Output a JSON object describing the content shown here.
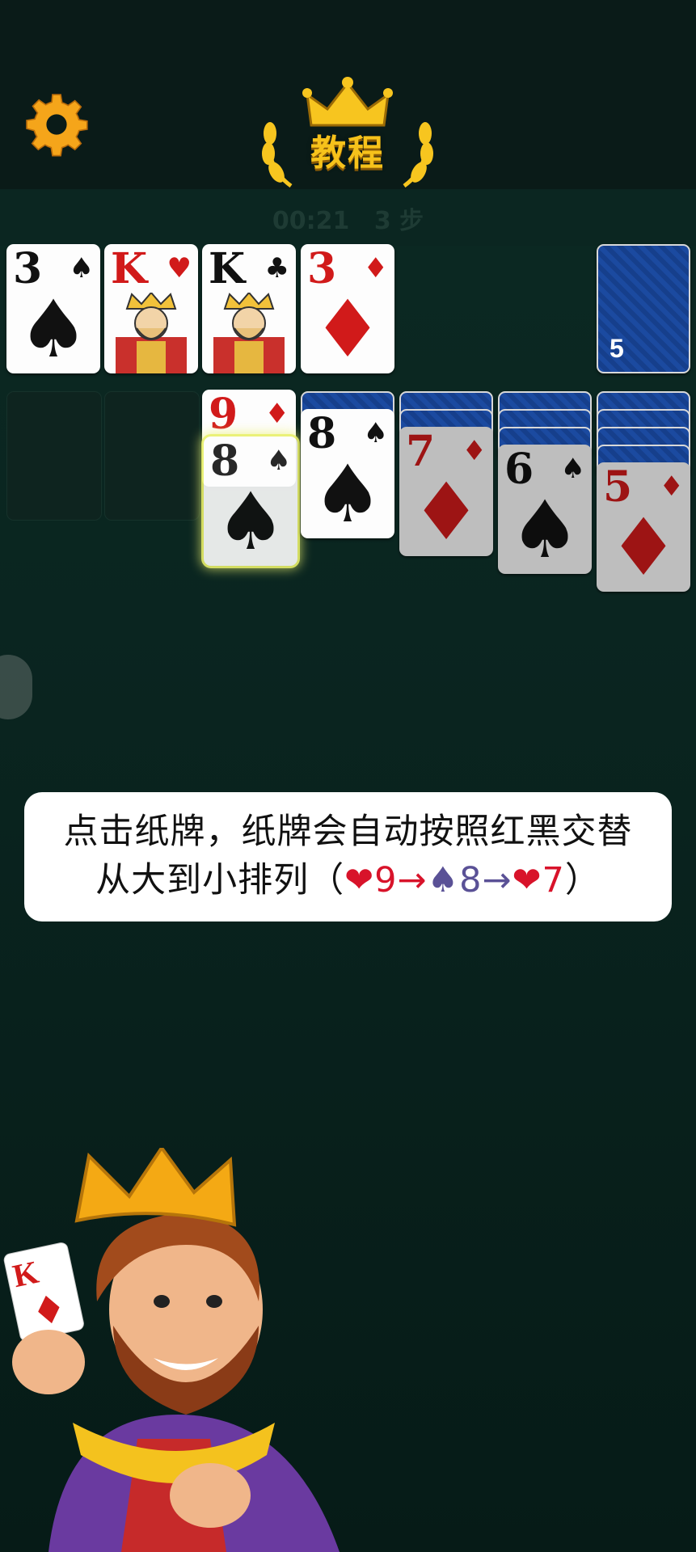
{
  "header": {
    "title": "教程",
    "settings_icon": "gear-icon",
    "crown_icon": "crown-icon",
    "accent_color": "#f6c21b"
  },
  "stats": {
    "timer": "00:21",
    "moves": "3 步"
  },
  "foundations": [
    {
      "rank": "3",
      "suit": "♠",
      "color": "black"
    },
    {
      "rank": "K",
      "suit": "♥",
      "color": "red",
      "face": "king"
    },
    {
      "rank": "K",
      "suit": "♣",
      "color": "black",
      "face": "king"
    },
    {
      "rank": "3",
      "suit": "♦",
      "color": "red"
    }
  ],
  "stock": {
    "count": "5"
  },
  "tableau": {
    "col3": [
      {
        "rank": "9",
        "suit": "♦",
        "color": "red"
      },
      {
        "rank": "8",
        "suit": "♠",
        "color": "black",
        "selected": true
      }
    ],
    "col4": {
      "rank": "8",
      "suit": "♠",
      "color": "black"
    },
    "col5": {
      "rank": "7",
      "suit": "♦",
      "color": "red"
    },
    "col6": {
      "rank": "6",
      "suit": "♠",
      "color": "black"
    },
    "col7": {
      "rank": "5",
      "suit": "♦",
      "color": "red"
    }
  },
  "tutorial": {
    "line1": "点击纸牌，纸牌会自动按照红黑交替",
    "line2_prefix": "从大到小排列（",
    "h_icon1": "❤",
    "n1": "9",
    "arrow1": "→",
    "s_icon": "♠",
    "n2": "8",
    "arrow2": "→",
    "h_icon2": "❤",
    "n3": "7",
    "line2_suffix": "）"
  },
  "mascot": {
    "card_rank": "K",
    "card_suit": "♦"
  }
}
